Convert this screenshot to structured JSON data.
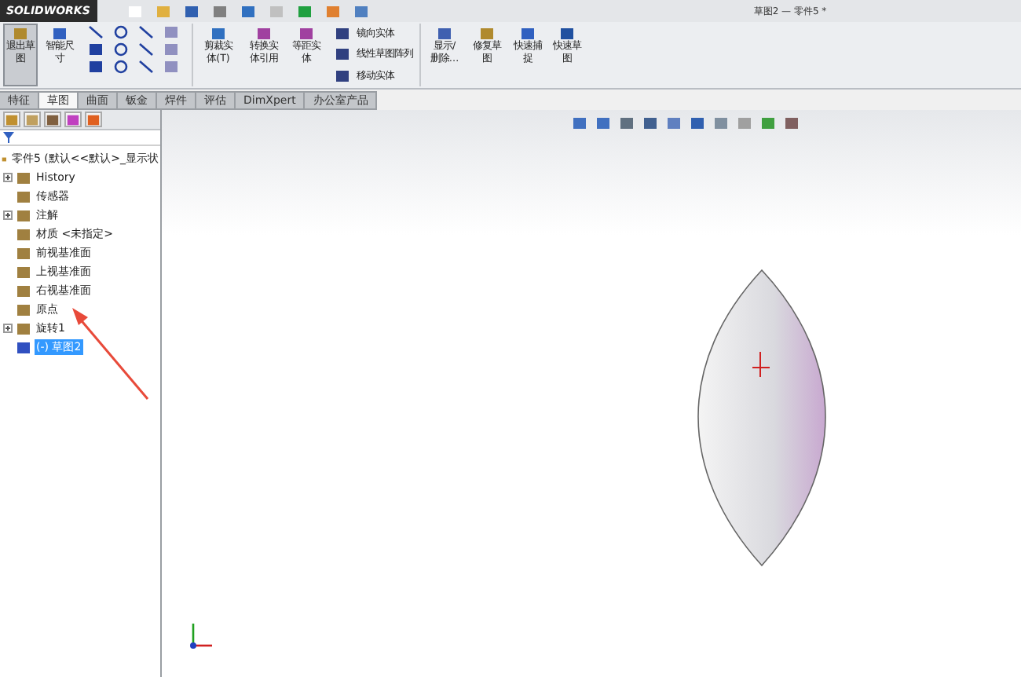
{
  "app": {
    "logo": "SOLIDWORKS",
    "title": "草图2 — 零件5 *"
  },
  "ribbon": [
    {
      "kind": "large",
      "label": "退出草图",
      "selected": true
    },
    {
      "kind": "large",
      "label": "智能尺寸",
      "selected": false
    },
    {
      "kind": "tools"
    },
    {
      "kind": "large",
      "label": "剪裁实体(T)",
      "selected": false
    },
    {
      "kind": "large",
      "label": "转换实体引用",
      "selected": false
    },
    {
      "kind": "large",
      "label": "等距实体",
      "selected": false
    },
    {
      "kind": "list",
      "entries": [
        "镜向实体",
        "线性草图阵列",
        "移动实体"
      ]
    },
    {
      "kind": "large",
      "label": "显示/删除…",
      "selected": false
    },
    {
      "kind": "large",
      "label": "修复草图",
      "selected": false
    },
    {
      "kind": "large",
      "label": "快速捕捉",
      "selected": false
    },
    {
      "kind": "large",
      "label": "快速草图",
      "selected": false
    }
  ],
  "tabs": [
    {
      "label": "特征",
      "selected": false
    },
    {
      "label": "草图",
      "selected": true
    },
    {
      "label": "曲面",
      "selected": false
    },
    {
      "label": "钣金",
      "selected": false
    },
    {
      "label": "焊件",
      "selected": false
    },
    {
      "label": "评估",
      "selected": false
    },
    {
      "label": "DimXpert",
      "selected": false
    },
    {
      "label": "办公室产品",
      "selected": false
    }
  ],
  "tree": {
    "root": "零件5 (默认<<默认>_显示状",
    "items": [
      {
        "label": "History",
        "expandable": true,
        "selected": false
      },
      {
        "label": "传感器",
        "expandable": false,
        "selected": false
      },
      {
        "label": "注解",
        "expandable": true,
        "selected": false
      },
      {
        "label": "材质 <未指定>",
        "expandable": false,
        "selected": false
      },
      {
        "label": "前视基准面",
        "expandable": false,
        "selected": false
      },
      {
        "label": "上视基准面",
        "expandable": false,
        "selected": false
      },
      {
        "label": "右视基准面",
        "expandable": false,
        "selected": false
      },
      {
        "label": "原点",
        "expandable": false,
        "selected": false
      },
      {
        "label": "旋转1",
        "expandable": true,
        "selected": false
      },
      {
        "label": "(-) 草图2",
        "expandable": false,
        "selected": true
      }
    ]
  }
}
